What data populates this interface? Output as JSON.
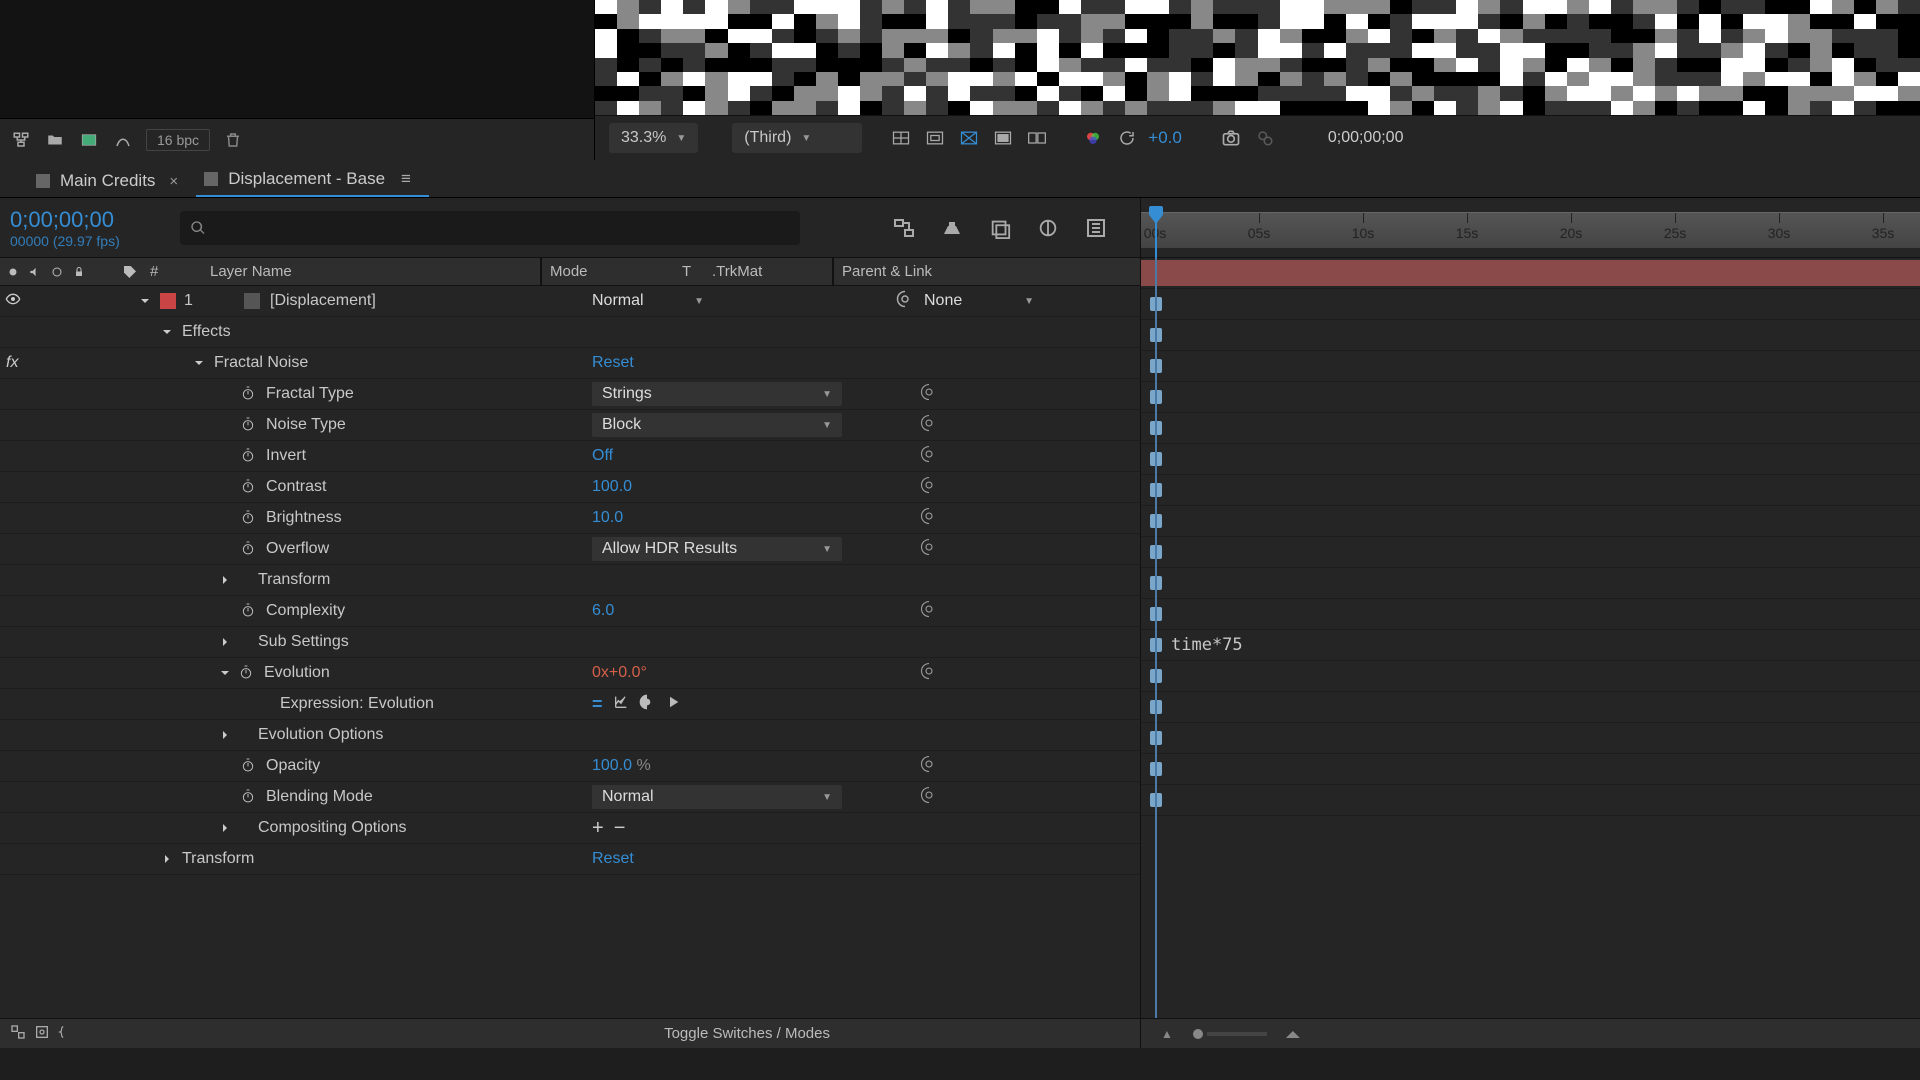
{
  "viewer": {
    "zoom": "33.3%",
    "resolution": "(Third)",
    "exposure": "+0.0",
    "timecode": "0;00;00;00"
  },
  "project_toolbar": {
    "bpc": "16 bpc"
  },
  "tabs": {
    "tab1": "Main Credits",
    "tab2": "Displacement - Base"
  },
  "timeline": {
    "current_time": "0;00;00;00",
    "frame_info": "00000 (29.97 fps)",
    "columns": {
      "num": "#",
      "layer_name": "Layer Name",
      "mode": "Mode",
      "t": "T",
      "trkmat": ".TrkMat",
      "parent": "Parent & Link"
    },
    "layer": {
      "index": "1",
      "name": "[Displacement]",
      "mode": "Normal",
      "parent": "None"
    },
    "effects_label": "Effects",
    "effect_name": "Fractal Noise",
    "reset": "Reset",
    "props": {
      "fractal_type": {
        "label": "Fractal Type",
        "value": "Strings"
      },
      "noise_type": {
        "label": "Noise Type",
        "value": "Block"
      },
      "invert": {
        "label": "Invert",
        "value": "Off"
      },
      "contrast": {
        "label": "Contrast",
        "value": "100.0"
      },
      "brightness": {
        "label": "Brightness",
        "value": "10.0"
      },
      "overflow": {
        "label": "Overflow",
        "value": "Allow HDR Results"
      },
      "transform": {
        "label": "Transform"
      },
      "complexity": {
        "label": "Complexity",
        "value": "6.0"
      },
      "sub_settings": {
        "label": "Sub Settings"
      },
      "evolution": {
        "label": "Evolution",
        "turns": "0",
        "x": "x",
        "deg": "+0.0",
        "suffix": "°"
      },
      "expression_evolution": {
        "label": "Expression: Evolution"
      },
      "evolution_options": {
        "label": "Evolution Options"
      },
      "opacity": {
        "label": "Opacity",
        "value": "100.0",
        "suffix": "%"
      },
      "blending_mode": {
        "label": "Blending Mode",
        "value": "Normal"
      },
      "compositing_options": {
        "label": "Compositing Options"
      }
    },
    "transform_group": {
      "label": "Transform",
      "reset": "Reset"
    },
    "expression_text": "time*75",
    "footer": "Toggle Switches / Modes"
  },
  "ruler": {
    "ticks": [
      "00s",
      "05s",
      "10s",
      "15s",
      "20s",
      "25s",
      "30s",
      "35s"
    ]
  }
}
